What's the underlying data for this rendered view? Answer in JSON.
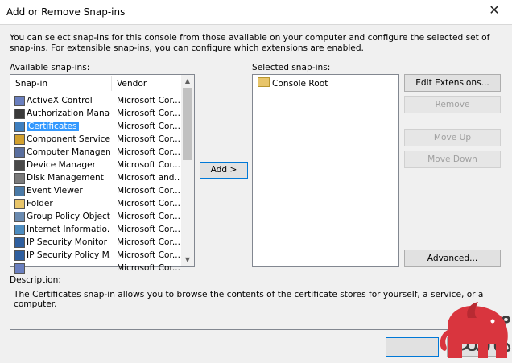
{
  "window": {
    "title": "Add or Remove Snap-ins"
  },
  "intro": "You can select snap-ins for this console from those available on your computer and configure the selected set of snap-ins. For extensible snap-ins, you can configure which extensions are enabled.",
  "available": {
    "label": "Available snap-ins:",
    "columns": {
      "name": "Snap-in",
      "vendor": "Vendor"
    },
    "items": [
      {
        "name": "ActiveX Control",
        "vendor": "Microsoft Cor...",
        "icon": "activex-icon"
      },
      {
        "name": "Authorization Manager",
        "vendor": "Microsoft Cor...",
        "icon": "authorization-icon"
      },
      {
        "name": "Certificates",
        "vendor": "Microsoft Cor...",
        "icon": "certificates-icon"
      },
      {
        "name": "Component Services",
        "vendor": "Microsoft Cor...",
        "icon": "component-services-icon"
      },
      {
        "name": "Computer Managem...",
        "vendor": "Microsoft Cor...",
        "icon": "computer-management-icon"
      },
      {
        "name": "Device Manager",
        "vendor": "Microsoft Cor...",
        "icon": "device-manager-icon"
      },
      {
        "name": "Disk Management",
        "vendor": "Microsoft and...",
        "icon": "disk-management-icon"
      },
      {
        "name": "Event Viewer",
        "vendor": "Microsoft Cor...",
        "icon": "event-viewer-icon"
      },
      {
        "name": "Folder",
        "vendor": "Microsoft Cor...",
        "icon": "folder-icon"
      },
      {
        "name": "Group Policy Object ...",
        "vendor": "Microsoft Cor...",
        "icon": "group-policy-icon"
      },
      {
        "name": "Internet Informatio...",
        "vendor": "Microsoft Cor...",
        "icon": "iis-icon"
      },
      {
        "name": "IP Security Monitor",
        "vendor": "Microsoft Cor...",
        "icon": "ip-security-monitor-icon"
      },
      {
        "name": "IP Security Policy M...",
        "vendor": "Microsoft Cor...",
        "icon": "ip-security-policy-icon"
      },
      {
        "name": "",
        "vendor": "Microsoft Cor...",
        "icon": "link-icon"
      }
    ],
    "selected_index": 2
  },
  "buttons": {
    "add": "Add >",
    "edit_extensions": "Edit Extensions...",
    "remove": "Remove",
    "move_up": "Move Up",
    "move_down": "Move Down",
    "advanced": "Advanced..."
  },
  "selected": {
    "label": "Selected snap-ins:",
    "items": [
      {
        "name": "Console Root",
        "icon": "folder-icon"
      }
    ]
  },
  "description": {
    "label": "Description:",
    "text": "The Certificates snap-in allows you to browse the contents of the certificate stores for yourself, a service, or a computer."
  },
  "watermark": {
    "text": "میہن هاست",
    "color": "#d9353e"
  }
}
